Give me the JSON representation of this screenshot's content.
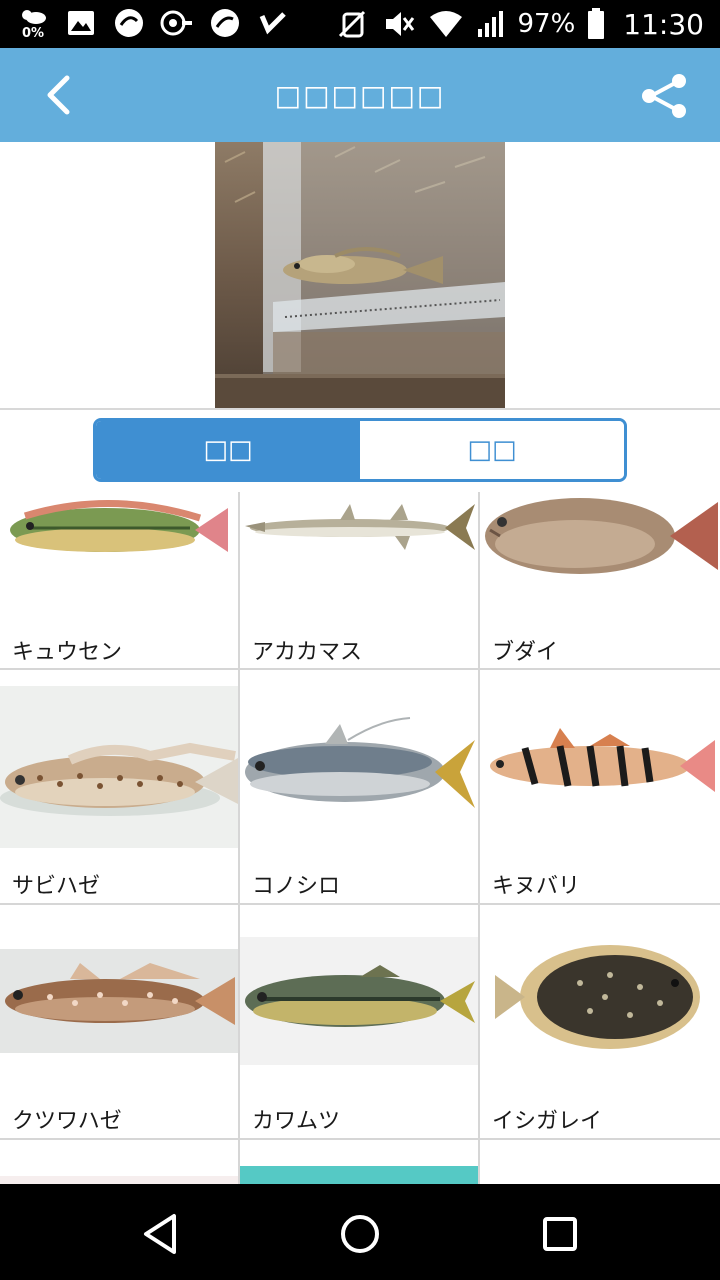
{
  "status_bar": {
    "data_usage": "0%",
    "battery_percent": "97%",
    "time": "11:30",
    "icons_left": [
      "weather-data-icon",
      "image-icon",
      "app-icon",
      "app-icon",
      "app-icon",
      "check-icon"
    ],
    "icons_right": [
      "nfc-icon",
      "mute-icon",
      "wifi-icon",
      "signal-icon",
      "battery-icon"
    ]
  },
  "app_bar": {
    "title": "□□□□□□",
    "color": "#63aedc"
  },
  "segment": {
    "left_label": "□□",
    "right_label": "□□",
    "active": "left",
    "accent": "#3f8fd2"
  },
  "fish_grid": [
    {
      "name": "キュウセン"
    },
    {
      "name": "アカカマス"
    },
    {
      "name": "ブダイ"
    },
    {
      "name": "サビハゼ"
    },
    {
      "name": "コノシロ"
    },
    {
      "name": "キヌバリ"
    },
    {
      "name": "クツワハゼ"
    },
    {
      "name": "カワムツ"
    },
    {
      "name": "イシガレイ"
    }
  ],
  "nav_bar": {
    "buttons": [
      "back-triangle-icon",
      "home-circle-icon",
      "recents-square-icon"
    ]
  }
}
